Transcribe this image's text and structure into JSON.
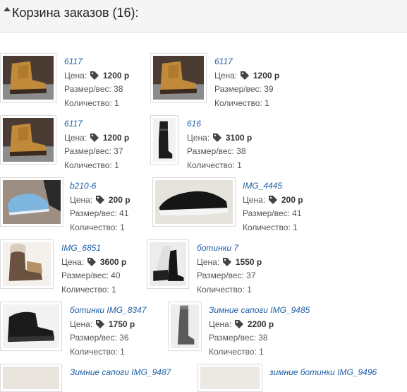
{
  "header": {
    "title": "Корзина заказов (16):",
    "caret_icon": "caret-up-icon"
  },
  "labels": {
    "price": "Цена:",
    "size": "Размер/вес:",
    "qty": "Количество:",
    "tag_icon": "tag-icon"
  },
  "items": [
    {
      "name": "6117",
      "price": "1200 р",
      "size": "38",
      "qty": "1",
      "photo": "brown-boot"
    },
    {
      "name": "6117",
      "price": "1200 р",
      "size": "39",
      "qty": "1",
      "photo": "brown-boot"
    },
    {
      "name": "6117",
      "price": "1200 р",
      "size": "37",
      "qty": "1",
      "photo": "brown-boot"
    },
    {
      "name": "616",
      "price": "3100 р",
      "size": "38",
      "qty": "1",
      "photo": "black-tall-boot"
    },
    {
      "name": "b210-6",
      "price": "200 р",
      "size": "41",
      "qty": "1",
      "photo": "blue-slip-on"
    },
    {
      "name": "IMG_4445",
      "price": "200 р",
      "size": "41",
      "qty": "1",
      "photo": "black-sneaker"
    },
    {
      "name": "IMG_6851",
      "price": "3600 р",
      "size": "40",
      "qty": "1",
      "photo": "fur-boot"
    },
    {
      "name": "ботинки 7",
      "price": "1550 р",
      "size": "37",
      "qty": "1",
      "photo": "black-ankle-boot"
    },
    {
      "name": "ботинки IMG_8347",
      "price": "1750 р",
      "size": "36",
      "qty": "1",
      "photo": "black-low-boot"
    },
    {
      "name": "Зимние сапоги IMG_9485",
      "price": "2200 р",
      "size": "38",
      "qty": "1",
      "photo": "grey-tall-boot"
    },
    {
      "name": "Зимние сапоги IMG_9487",
      "photo": "partial"
    },
    {
      "name": "зимние ботинки IMG_9496",
      "photo": "partial"
    }
  ]
}
